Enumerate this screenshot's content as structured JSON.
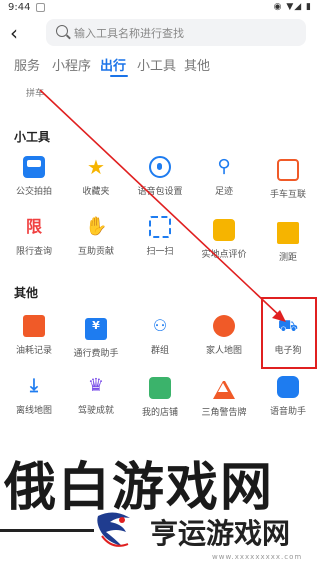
{
  "status_bar": {
    "time": "9:44"
  },
  "search": {
    "placeholder": "输入工具名称进行查找"
  },
  "tabs": [
    {
      "label": "服务"
    },
    {
      "label": "小程序"
    },
    {
      "label": "出行",
      "active": true
    },
    {
      "label": "小工具"
    },
    {
      "label": "其他"
    }
  ],
  "partial_item": {
    "label": "拼车"
  },
  "sections": {
    "tools": {
      "title": "小工具",
      "items": [
        {
          "label": "公交拍拍",
          "icon": "bus-icon"
        },
        {
          "label": "收藏夹",
          "icon": "star-icon"
        },
        {
          "label": "语音包设置",
          "icon": "voice-pack-icon"
        },
        {
          "label": "足迹",
          "icon": "footprint-icon"
        },
        {
          "label": "手车互联",
          "icon": "car-link-icon"
        },
        {
          "label": "限行查询",
          "icon": "traffic-limit-icon"
        },
        {
          "label": "互助贡献",
          "icon": "handshake-icon"
        },
        {
          "label": "扫一扫",
          "icon": "scan-icon"
        },
        {
          "label": "实地点评价",
          "icon": "review-icon"
        },
        {
          "label": "测距",
          "icon": "ruler-icon"
        }
      ]
    },
    "other": {
      "title": "其他",
      "items": [
        {
          "label": "油耗记录",
          "icon": "fuel-icon"
        },
        {
          "label": "通行费助手",
          "icon": "toll-icon"
        },
        {
          "label": "群组",
          "icon": "group-icon"
        },
        {
          "label": "家人地图",
          "icon": "family-map-icon"
        },
        {
          "label": "电子狗",
          "icon": "camera-dog-icon"
        },
        {
          "label": "离线地图",
          "icon": "download-icon"
        },
        {
          "label": "驾驶成就",
          "icon": "trophy-icon"
        },
        {
          "label": "我的店铺",
          "icon": "shop-icon"
        },
        {
          "label": "三角警告牌",
          "icon": "warning-triangle-icon"
        },
        {
          "label": "语音助手",
          "icon": "mic-icon"
        }
      ]
    }
  },
  "watermark": {
    "big_text": "俄白游戏网",
    "small_text": "亨运游戏网",
    "url": "www.xxxxxxxxx.com"
  },
  "colors": {
    "accent": "#1a73e8",
    "highlight": "#e02020"
  }
}
